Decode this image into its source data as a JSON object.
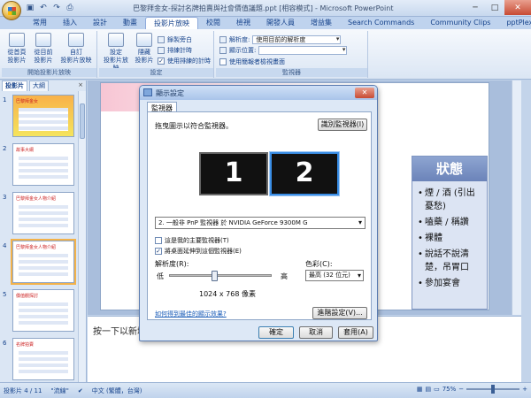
{
  "window": {
    "title": "巴黎拜金女-探討名牌拍賣與社會價值議題.ppt [相容模式] - Microsoft PowerPoint",
    "min": "─",
    "max": "□",
    "close": "✕"
  },
  "qat": [
    "save-icon",
    "undo-icon",
    "redo-icon",
    "print-icon"
  ],
  "ribbon_tabs": [
    "常用",
    "插入",
    "設計",
    "動畫",
    "投影片放映",
    "校閱",
    "檢視",
    "開發人員",
    "增益集",
    "Search Commands",
    "Community Clips",
    "pptPlex"
  ],
  "active_tab_index": 4,
  "ribbon": {
    "start_group": {
      "from_start": "從首頁\n投影片",
      "from_current": "從目前\n投影片",
      "custom": "自訂\n投影片放映",
      "label": "開始投影片放映"
    },
    "setup_group": {
      "setup": "設定\n投影片放映",
      "hide": "隱藏\n投影片",
      "record": "錄製旁白",
      "rehearse": "排練計時",
      "use_timings": "使用排練的計時",
      "use_timings_checked": true,
      "label": "設定"
    },
    "monitors_group": {
      "resolution_label": "解析度:",
      "resolution_value": "使用目前的解析度",
      "show_on_label": "顯示位置:",
      "show_on_value": "",
      "presenter_view": "使用簡報者檢視畫面",
      "presenter_view_checked": false,
      "label": "監視器"
    }
  },
  "leftpane": {
    "tab_slides": "投影片",
    "tab_outline": "大綱",
    "close": "×",
    "thumbs": [
      {
        "num": "1",
        "title": "巴黎拜金女"
      },
      {
        "num": "2",
        "title": "故事大綱"
      },
      {
        "num": "3",
        "title": "巴黎拜金女人物介紹"
      },
      {
        "num": "4",
        "title": "巴黎拜金女人物介紹"
      },
      {
        "num": "5",
        "title": "價值觀探討"
      },
      {
        "num": "6",
        "title": "名牌拍賣"
      }
    ],
    "selected_index": 3
  },
  "slide": {
    "status_title": "狀態",
    "items": [
      "煙 / 酒 (引出憂愁)",
      "嗑藥 / 稱讚",
      "裸體",
      "說話不說清楚，吊胃口",
      "參加宴會"
    ]
  },
  "notes": {
    "placeholder": "按一下以新增備忘稿"
  },
  "statusbar": {
    "slide_info": "投影片 4 / 11",
    "theme": "\"流線\"",
    "language": "中文 (繁體，台灣)",
    "zoom": "75%",
    "zoom_pct": 75
  },
  "dialog": {
    "title": "顯示設定",
    "close": "✕",
    "tab": "監視器",
    "drag_hint": "拖曳圖示以符合監視器。",
    "identify_btn": "識別監視器(I)",
    "monitor1": "1",
    "monitor2": "2",
    "monitor_select": "2. 一般非 PnP 監視器 於 NVIDIA GeForce 9300M G",
    "primary_label": "這是我的主要監視器(T)",
    "primary_checked": false,
    "extend_label": "將桌面延伸到這個監視器(E)",
    "extend_checked": true,
    "resolution_label": "解析度(R):",
    "low": "低",
    "high": "高",
    "resolution_value": "1024 x 768 像素",
    "resolution_fraction": 0.43,
    "color_label": "色彩(C):",
    "color_value": "最高 (32 位元)",
    "link": "如何得到最佳的顯示效果?",
    "advanced_btn": "進階設定(V)...",
    "ok_btn": "確定",
    "cancel_btn": "取消",
    "apply_btn": "套用(A)"
  },
  "colors": {
    "accent": "#15428b",
    "card_head": "#7a91c4",
    "selected_thumb": "#f3b24a"
  }
}
